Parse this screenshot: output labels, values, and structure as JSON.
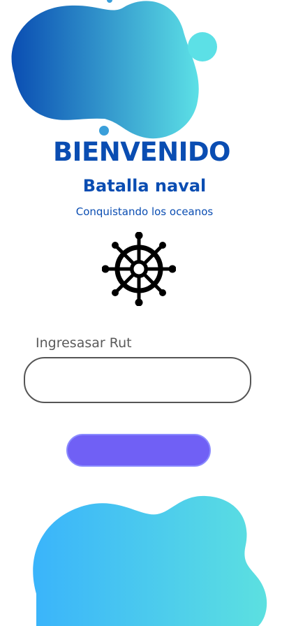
{
  "header": {
    "welcome": "BIENVENIDO",
    "title": "Batalla naval",
    "subtitle": "Conquistando los oceanos"
  },
  "logo": {
    "icon": "ship-wheel-icon"
  },
  "form": {
    "rut_label": "Ingresasar Rut",
    "rut_value": "",
    "submit_label": ""
  },
  "colors": {
    "primary_text": "#0a4db2",
    "button": "#7060f5",
    "gradient_top_start": "#0a4db2",
    "gradient_top_end": "#5ce0e6",
    "gradient_bottom_start": "#3ab4fb",
    "gradient_bottom_end": "#5ce0e0"
  }
}
